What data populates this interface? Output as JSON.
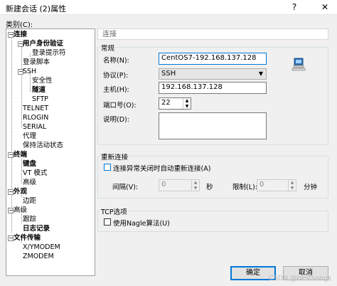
{
  "window": {
    "title": "新建会话 (2)属性",
    "help_btn": "?",
    "close_btn": "✕"
  },
  "category_label": "类别(C):",
  "tree": [
    {
      "label": "连接",
      "bold": true
    },
    {
      "label": "用户身份验证",
      "bold": true
    },
    {
      "label": "登录提示符",
      "bold": false
    },
    {
      "label": "登录脚本",
      "bold": false
    },
    {
      "label": "SSH",
      "bold": false
    },
    {
      "label": "安全性",
      "bold": false
    },
    {
      "label": "隧道",
      "bold": true
    },
    {
      "label": "SFTP",
      "bold": false
    },
    {
      "label": "TELNET",
      "bold": false
    },
    {
      "label": "RLOGIN",
      "bold": false
    },
    {
      "label": "SERIAL",
      "bold": false
    },
    {
      "label": "代理",
      "bold": false
    },
    {
      "label": "保持活动状态",
      "bold": false
    },
    {
      "label": "终端",
      "bold": true
    },
    {
      "label": "键盘",
      "bold": true
    },
    {
      "label": "VT 模式",
      "bold": false
    },
    {
      "label": "高级",
      "bold": false
    },
    {
      "label": "外观",
      "bold": true
    },
    {
      "label": "边距",
      "bold": false
    },
    {
      "label": "高级",
      "bold": false
    },
    {
      "label": "跟踪",
      "bold": false
    },
    {
      "label": "日志记录",
      "bold": true
    },
    {
      "label": "文件传输",
      "bold": true
    },
    {
      "label": "X/YMODEM",
      "bold": false
    },
    {
      "label": "ZMODEM",
      "bold": false
    }
  ],
  "panel_title": "连接",
  "general": {
    "group_label": "常规",
    "name_label": "名称(N):",
    "name_value": "CentOS7-192.168.137.128",
    "protocol_label": "协议(P):",
    "protocol_value": "SSH",
    "host_label": "主机(H):",
    "host_value": "192.168.137.128",
    "port_label": "端口号(O):",
    "port_value": "22",
    "desc_label": "说明(D):"
  },
  "reconnect": {
    "group_label": "重新连接",
    "checkbox_label": "连接异常关闭时自动重新连接(A)",
    "interval_label": "间隔(V):",
    "interval_value": "0",
    "interval_unit": "秒",
    "limit_label": "限制(L):",
    "limit_value": "0",
    "limit_unit": "分钟"
  },
  "tcp": {
    "group_label": "TCP选项",
    "checkbox_label": "使用Nagle算法(U)"
  },
  "buttons": {
    "ok": "确定",
    "cancel": "取消"
  },
  "watermark": "CSDN @bestsongs",
  "colors": {
    "accent": "#0078d7",
    "computer_icon": "#2a6fb8"
  }
}
